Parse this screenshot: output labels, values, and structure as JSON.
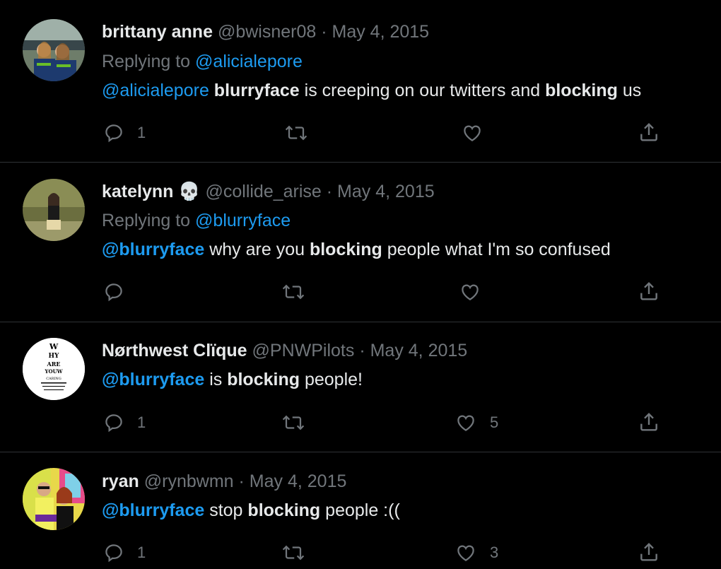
{
  "tweets": [
    {
      "name": "brittany anne",
      "handle": "@bwisner08",
      "date": "· May 4, 2015",
      "replying_label": "Replying to",
      "replying_to": "@alicialepore",
      "text": {
        "m1": "@alicialepore",
        "b1": "blurryface",
        "t1": " is creeping on our twitters and ",
        "b2": "blocking",
        "t2": " us"
      },
      "reply_count": "1",
      "retweet_count": "",
      "like_count": ""
    },
    {
      "name": "katelynn",
      "name_emoji": "💀",
      "handle": "@collide_arise",
      "date": "· May 4, 2015",
      "replying_label": "Replying to",
      "replying_to": "@blurryface",
      "text": {
        "m1": "@blurryface",
        "t1": " why are you ",
        "b1": "blocking",
        "t2": " people what I'm so confused"
      },
      "reply_count": "",
      "retweet_count": "",
      "like_count": ""
    },
    {
      "name": "Nørthwest Clïque",
      "handle": "@PNWPilots",
      "date": "· May 4, 2015",
      "text": {
        "m1": "@blurryface",
        "t1": " is ",
        "b1": "blocking",
        "t2": " people!"
      },
      "avatar_text": [
        "W",
        "HY",
        "ARE",
        "YOUW",
        "CARING"
      ],
      "reply_count": "1",
      "retweet_count": "",
      "like_count": "5"
    },
    {
      "name": "ryan",
      "handle": "@rynbwmn",
      "date": "· May 4, 2015",
      "text": {
        "m1": "@blurryface",
        "t1": " stop ",
        "b1": "blocking",
        "t2": " people :(("
      },
      "reply_count": "1",
      "retweet_count": "",
      "like_count": "3"
    }
  ],
  "colors": {
    "background": "#000000",
    "text": "#e7e9ea",
    "muted": "#71767b",
    "accent": "#1d9bf0",
    "divider": "#2f3336"
  },
  "icons": [
    "reply-icon",
    "retweet-icon",
    "like-icon",
    "share-icon",
    "skull-emoji"
  ]
}
